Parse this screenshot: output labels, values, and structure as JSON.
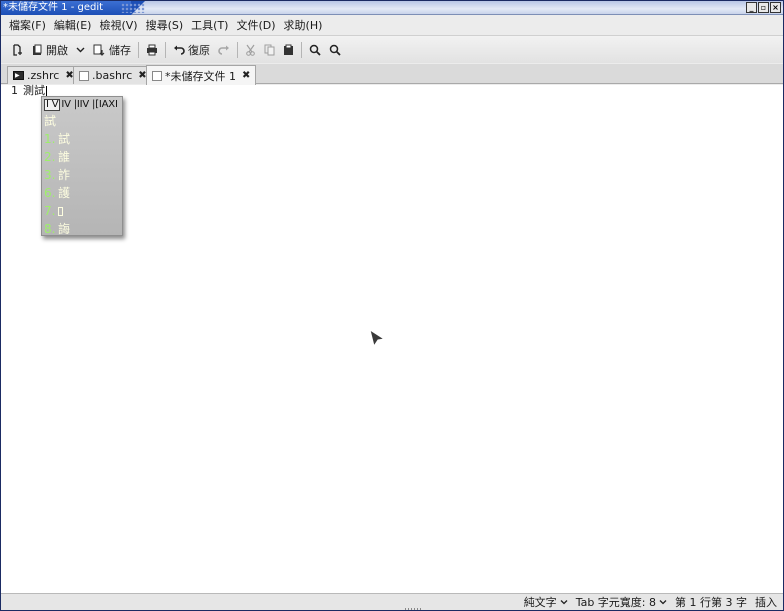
{
  "window": {
    "title": "*未儲存文件 1 - gedit",
    "buttons": [
      "_",
      "▫",
      "×"
    ]
  },
  "menu": [
    "檔案(F)",
    "編輯(E)",
    "檢視(V)",
    "搜尋(S)",
    "工具(T)",
    "文件(D)",
    "求助(H)"
  ],
  "toolbar": {
    "open_label": "開啟",
    "save_label": "儲存",
    "undo_label": "復原"
  },
  "tabs": [
    {
      "label": ".zshrc",
      "icon": "terminal-icon"
    },
    {
      "label": ".bashrc",
      "icon": "document-icon"
    },
    {
      "label": "*未儲存文件 1",
      "icon": "document-icon",
      "active": true
    }
  ],
  "editor": {
    "line_number": "1",
    "text": "測試"
  },
  "ime": {
    "modes": [
      "I V",
      "IV",
      "IIV",
      "IAXI"
    ],
    "preedit": "試",
    "candidates": [
      {
        "num": "1.",
        "char": "試"
      },
      {
        "num": "2.",
        "char": "誰"
      },
      {
        "num": "3.",
        "char": "詐"
      },
      {
        "num": "6.",
        "char": "護"
      },
      {
        "num": "7.",
        "char": ""
      },
      {
        "num": "8.",
        "char": "誨"
      }
    ]
  },
  "status": {
    "language": "純文字",
    "tab_width": "Tab 字元寬度: 8",
    "position": "第 1 行第 3 字",
    "mode": "插入"
  },
  "colors": {
    "accent": "#1d4fb6",
    "candidate_number": "#9ef06a",
    "candidate_text": "#fdfde0"
  }
}
